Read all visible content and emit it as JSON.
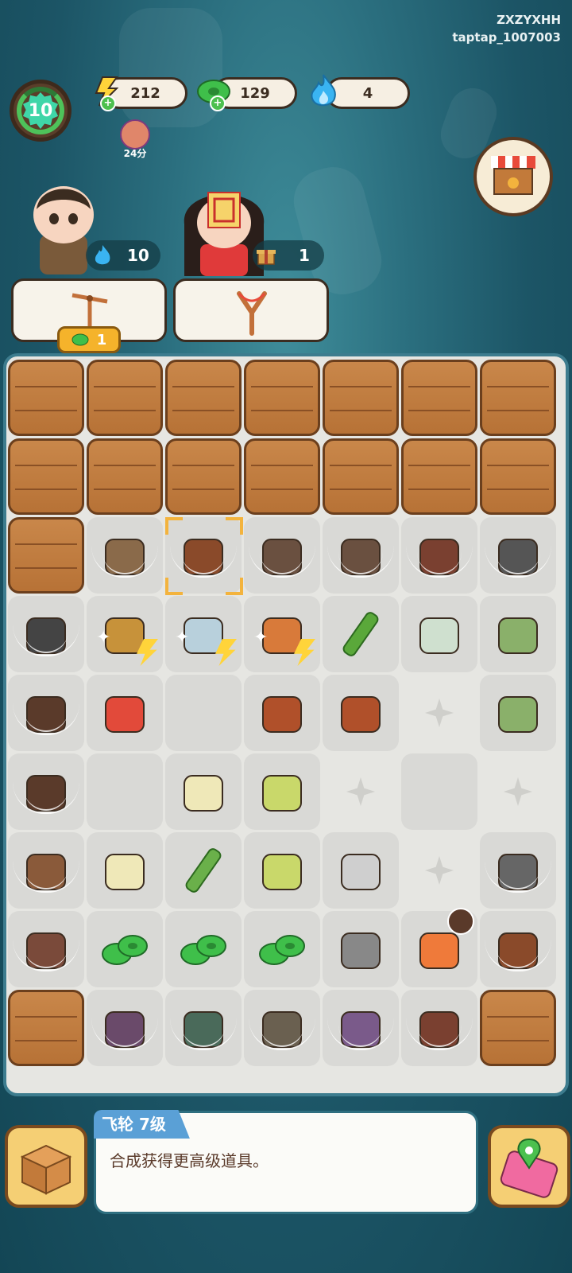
{
  "header": {
    "user_name": "ZXZYXHH",
    "user_id": "taptap_1007003",
    "level": "10",
    "score_label": "24分"
  },
  "resources": {
    "energy": "212",
    "jade_coins": "129",
    "blue_flame": "4"
  },
  "characters": {
    "left_count": "10",
    "right_count": "1"
  },
  "tools": {
    "left_tool_cost": "1"
  },
  "info_panel": {
    "item_name": "飞轮 7级",
    "description": "合成获得更高级道具。"
  },
  "colors": {
    "wood": "#b77236",
    "slot": "#d9d9d6",
    "board": "#e6e6e2",
    "accent_blue": "#5aa0d6",
    "jade": "#3fbf4a",
    "energy": "#ffd43a"
  },
  "board": {
    "rows": [
      [
        "wood",
        "wood",
        "wood",
        "wood",
        "wood",
        "wood",
        "wood"
      ],
      [
        "wood",
        "wood",
        "wood",
        "wood",
        "wood",
        "wood",
        "wood"
      ],
      [
        "wood",
        "webbed-sticks",
        "webbed-saddle-selected",
        "webbed-rocks",
        "webbed-rocks",
        "webbed-bag",
        "webbed-sickle"
      ],
      [
        "webbed-pot",
        "cabinet-bolt",
        "tea-set-bolt",
        "shelf-bolt",
        "bamboo",
        "tea-pouch",
        "tea-packet"
      ],
      [
        "webbed-box",
        "treasure-bag",
        "slot-empty",
        "wooden-chest",
        "wooden-chest",
        "empty-sparkle",
        "tea-packet"
      ],
      [
        "webbed-trunk",
        "slot-empty",
        "feather-duster",
        "whisk-broom",
        "empty-sparkle",
        "slot-empty",
        "empty-sparkle"
      ],
      [
        "webbed-horse",
        "feather-duster",
        "bamboo-hammer",
        "whisk-broom",
        "scissors",
        "empty-sparkle",
        "webbed-axe"
      ],
      [
        "webbed-cart",
        "jade-coin-pile",
        "jade-coin-stack",
        "jade-coin-small",
        "energy-bolts",
        "treasure-chest-timer",
        "webbed-telescope"
      ],
      [
        "wood",
        "webbed-sack",
        "webbed-sack-green",
        "webbed-jar",
        "webbed-incense",
        "webbed-bowl",
        "wood"
      ]
    ]
  }
}
